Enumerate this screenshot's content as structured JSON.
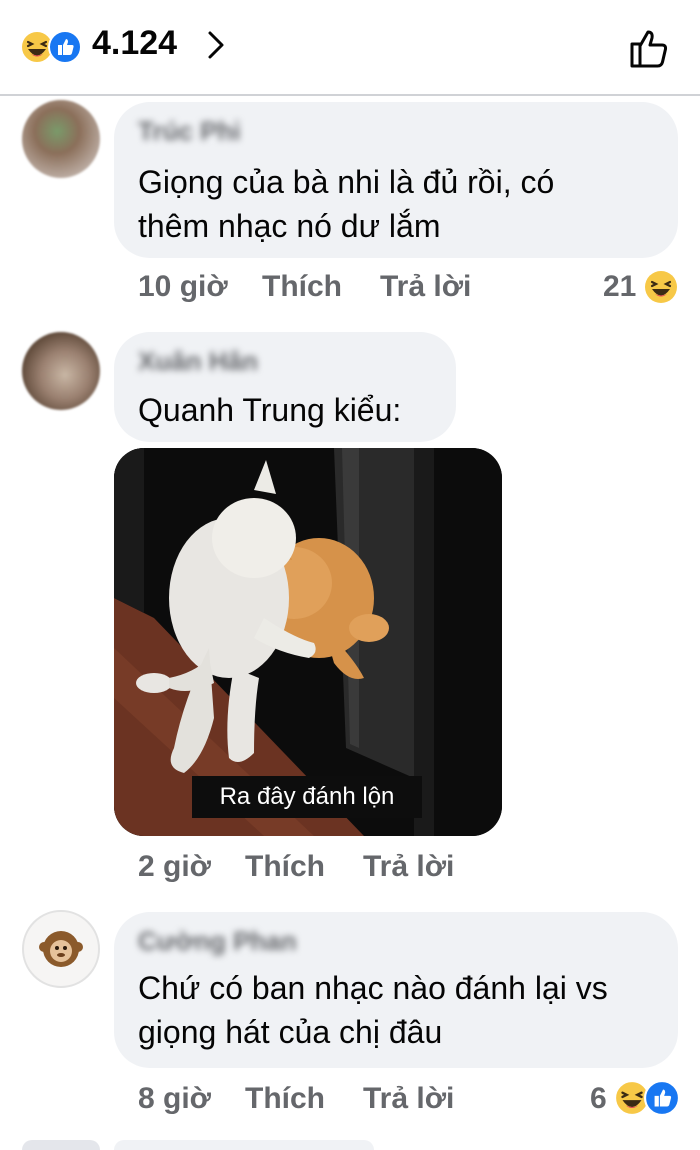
{
  "reactions_bar": {
    "icons": [
      "haha-emoji",
      "like"
    ],
    "count": "4.124",
    "colors": {
      "haha": "#f7c847",
      "like": "#1877f2"
    }
  },
  "comments": [
    {
      "name": "Trúc Phi",
      "text": [
        "Giọng của bà nhi là đủ rồi, có",
        "thêm nhạc nó dư lắm"
      ],
      "time": "10 giờ",
      "like_label": "Thích",
      "reply_label": "Trả lời",
      "reaction_count": "21"
    },
    {
      "name": "Xuân Hân",
      "text": [
        "Quanh Trung kiểu:"
      ],
      "image_caption": "Ra đây đánh lộn",
      "time": "2 giờ",
      "like_label": "Thích",
      "reply_label": "Trả lời"
    },
    {
      "name": "Cường Phan",
      "text": [
        "Chứ có ban nhạc nào đánh lại vs",
        "giọng hát của chị đâu"
      ],
      "time": "8 giờ",
      "like_label": "Thích",
      "reply_label": "Trả lời",
      "reaction_count": "6"
    }
  ]
}
